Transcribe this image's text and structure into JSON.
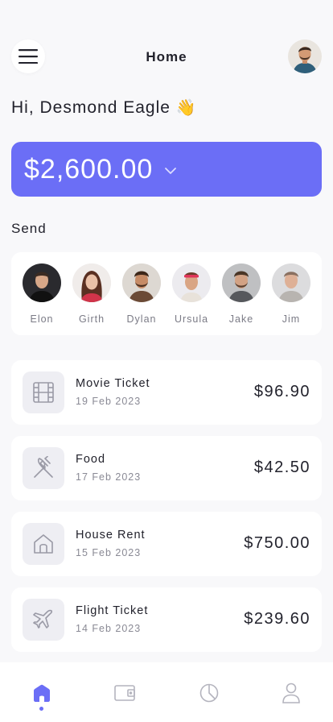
{
  "header": {
    "title": "Home"
  },
  "greeting": {
    "text": "Hi, Desmond Eagle",
    "emoji": "👋"
  },
  "balance": {
    "amount": "$2,600.00"
  },
  "send": {
    "title": "Send",
    "contacts": [
      {
        "name": "Elon"
      },
      {
        "name": "Girth"
      },
      {
        "name": "Dylan"
      },
      {
        "name": "Ursula"
      },
      {
        "name": "Jake"
      },
      {
        "name": "Jim"
      }
    ]
  },
  "transactions": [
    {
      "title": "Movie Ticket",
      "date": "19 Feb 2023",
      "amount": "$96.90",
      "icon": "film-icon"
    },
    {
      "title": "Food",
      "date": "17 Feb 2023",
      "amount": "$42.50",
      "icon": "utensils-icon"
    },
    {
      "title": "House Rent",
      "date": "15 Feb 2023",
      "amount": "$750.00",
      "icon": "house-icon"
    },
    {
      "title": "Flight Ticket",
      "date": "14 Feb 2023",
      "amount": "$239.60",
      "icon": "plane-icon"
    }
  ],
  "nav": {
    "items": [
      "home-icon",
      "wallet-icon",
      "chart-icon",
      "profile-icon"
    ],
    "active": 0
  },
  "colors": {
    "accent": "#6b6ef6",
    "background": "#f8f8fa",
    "card": "#ffffff",
    "icon_tile": "#eeeef3",
    "muted_text": "#8a8a95"
  }
}
